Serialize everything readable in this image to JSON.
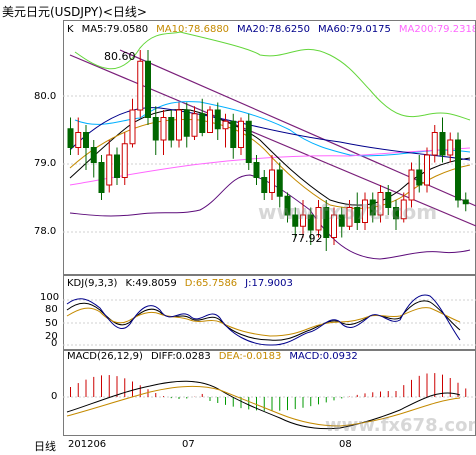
{
  "title": "美元日元(USDJPY)<日线>",
  "price_panel": {
    "label": "K",
    "ma_text": [
      {
        "text": "MA5:79.0580",
        "color": "#000000"
      },
      {
        "text": "MA10:78.6880",
        "color": "#c48a00"
      },
      {
        "text": "MA20:78.6250",
        "color": "#00008b"
      },
      {
        "text": "MA60:79.0175",
        "color": "#00008b"
      },
      {
        "text": "MA200:79.2318",
        "color": "#ff66ff"
      }
    ],
    "y_ticks": [
      "80.0",
      "79.0",
      "78.0"
    ],
    "high_label": "80.60",
    "low_label": "77.92"
  },
  "kdj_panel": {
    "label": "KDJ(9,3,3)",
    "values": [
      {
        "text": "K:49.8059",
        "color": "#000000"
      },
      {
        "text": "D:65.7586",
        "color": "#c48a00"
      },
      {
        "text": "J:17.9003",
        "color": "#00008b"
      }
    ],
    "y_ticks": [
      "100",
      "80",
      "50",
      "20",
      "0"
    ]
  },
  "macd_panel": {
    "label": "MACD(26,12,9)",
    "values": [
      {
        "text": "DIFF:0.0283",
        "color": "#000000"
      },
      {
        "text": "DEA:-0.0183",
        "color": "#c48a00"
      },
      {
        "text": "MACD:0.0932",
        "color": "#00008b"
      }
    ],
    "y_ticks": [
      "0"
    ]
  },
  "x_axis": {
    "left_label": "日线",
    "ticks": [
      "201206",
      "07",
      "08"
    ]
  },
  "watermark": "www.fx678.com",
  "chart_data": {
    "type": "candlestick",
    "ylim": [
      77.6,
      81.0
    ],
    "candles": [
      [
        79.55,
        79.3,
        79.7,
        79.2
      ],
      [
        79.3,
        79.5,
        79.7,
        79.2
      ],
      [
        79.5,
        79.3,
        79.6,
        79.0
      ],
      [
        79.3,
        79.1,
        79.4,
        78.9
      ],
      [
        79.1,
        78.7,
        79.2,
        78.6
      ],
      [
        78.8,
        79.2,
        79.4,
        78.7
      ],
      [
        79.2,
        78.9,
        79.3,
        78.8
      ],
      [
        78.9,
        79.35,
        79.5,
        78.8
      ],
      [
        79.35,
        79.8,
        79.95,
        79.3
      ],
      [
        79.8,
        80.45,
        80.6,
        79.7
      ],
      [
        80.45,
        79.7,
        80.6,
        79.6
      ],
      [
        79.7,
        79.4,
        79.85,
        79.2
      ],
      [
        79.4,
        79.7,
        79.8,
        79.2
      ],
      [
        79.7,
        79.4,
        79.8,
        79.3
      ],
      [
        79.4,
        79.8,
        79.9,
        79.3
      ],
      [
        79.8,
        79.45,
        79.9,
        79.3
      ],
      [
        79.45,
        79.75,
        79.85,
        79.4
      ],
      [
        79.75,
        79.5,
        79.95,
        79.45
      ],
      [
        79.5,
        79.8,
        79.85,
        79.5
      ],
      [
        79.8,
        79.55,
        79.9,
        79.4
      ],
      [
        79.55,
        79.65,
        79.75,
        79.3
      ],
      [
        79.65,
        79.3,
        79.75,
        79.15
      ],
      [
        79.3,
        79.65,
        79.7,
        79.2
      ],
      [
        79.65,
        79.1,
        79.75,
        79.0
      ],
      [
        79.1,
        78.9,
        79.2,
        78.8
      ],
      [
        78.9,
        78.7,
        79.0,
        78.6
      ],
      [
        78.7,
        79.0,
        79.2,
        78.6
      ],
      [
        79.0,
        78.65,
        79.1,
        78.5
      ],
      [
        78.65,
        78.4,
        78.7,
        78.3
      ],
      [
        78.4,
        78.25,
        78.5,
        78.1
      ],
      [
        78.25,
        78.4,
        78.6,
        78.1
      ],
      [
        78.4,
        78.2,
        78.5,
        78.0
      ],
      [
        78.2,
        78.5,
        78.6,
        78.1
      ],
      [
        78.5,
        78.1,
        78.6,
        77.92
      ],
      [
        78.1,
        78.4,
        78.5,
        78.0
      ],
      [
        78.4,
        78.25,
        78.5,
        78.1
      ],
      [
        78.25,
        78.5,
        78.6,
        78.2
      ],
      [
        78.5,
        78.3,
        78.7,
        78.2
      ],
      [
        78.3,
        78.6,
        78.7,
        78.2
      ],
      [
        78.6,
        78.4,
        78.7,
        78.3
      ],
      [
        78.4,
        78.7,
        78.8,
        78.3
      ],
      [
        78.7,
        78.5,
        78.8,
        78.4
      ],
      [
        78.5,
        78.35,
        78.6,
        78.2
      ],
      [
        78.35,
        78.6,
        78.7,
        78.3
      ],
      [
        78.6,
        79.0,
        79.1,
        78.5
      ],
      [
        79.0,
        78.8,
        79.2,
        78.7
      ],
      [
        78.8,
        79.2,
        79.3,
        78.7
      ],
      [
        79.2,
        79.5,
        79.6,
        79.1
      ],
      [
        79.5,
        79.2,
        79.7,
        79.1
      ],
      [
        79.2,
        79.4,
        79.5,
        79.1
      ],
      [
        79.4,
        78.6,
        79.5,
        78.5
      ],
      [
        78.6,
        78.55,
        78.7,
        78.45
      ]
    ]
  }
}
